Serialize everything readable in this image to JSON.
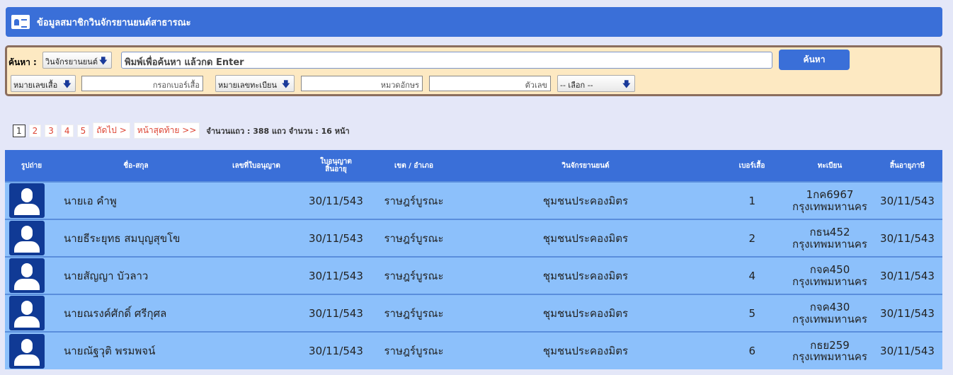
{
  "title": "ข้อมูลสมาชิกวินจักรยานยนต์สาธารณะ",
  "search": {
    "label": "ค้นหา :",
    "type_select": "วินจักรยานยนต์",
    "main_placeholder": "พิมพ์เพื่อค้นหา แล้วกด Enter",
    "button": "ค้นหา",
    "shirt_select": "หมายเลขเสื้อ",
    "shirt_placeholder": "กรอกเบอร์เสื้อ",
    "plate_select": "หมายเลขทะเบียน",
    "category_placeholder": "หมวดอักษร",
    "number_placeholder": "ตัวเลข",
    "province_select": "-- เลือก --"
  },
  "pager": {
    "pages": [
      "1",
      "2",
      "3",
      "4",
      "5"
    ],
    "next": "ถัดไป >",
    "last": "หน้าสุดท้าย >>",
    "info": "จำนวนแถว : 388 แถว  จำนวน : 16 หน้า"
  },
  "columns": [
    "รูปถ่าย",
    "ชื่อ-สกุล",
    "เลขที่ใบอนุญาต",
    "ใบอนุญาต สิ้นอายุ",
    "เขต / อำเภอ",
    "วินจักรยานยนต์",
    "เบอร์เสื้อ",
    "ทะเบียน",
    "สิ้นอายุภาษี"
  ],
  "rows": [
    {
      "name": "นายเอ  คำพู",
      "license_no": "",
      "expire": "30/11/543",
      "district": "ราษฎร์บูรณะ",
      "win": "ชุมชนประคองมิตร",
      "shirt": "1",
      "plate": "1กค6967",
      "province": "กรุงเทพมหานคร",
      "tax": "30/11/543"
    },
    {
      "name": "นายธีระยุทธ  สมบุญสุขโข",
      "license_no": "",
      "expire": "30/11/543",
      "district": "ราษฎร์บูรณะ",
      "win": "ชุมชนประคองมิตร",
      "shirt": "2",
      "plate": "กธน452",
      "province": "กรุงเทพมหานคร",
      "tax": "30/11/543"
    },
    {
      "name": "นายสัญญา  บัวลาว",
      "license_no": "",
      "expire": "30/11/543",
      "district": "ราษฎร์บูรณะ",
      "win": "ชุมชนประคองมิตร",
      "shirt": "4",
      "plate": "กจค450",
      "province": "กรุงเทพมหานคร",
      "tax": "30/11/543"
    },
    {
      "name": "นายณรงค์ศักดิ์  ศรีกุศล",
      "license_no": "",
      "expire": "30/11/543",
      "district": "ราษฎร์บูรณะ",
      "win": "ชุมชนประคองมิตร",
      "shirt": "5",
      "plate": "กจค430",
      "province": "กรุงเทพมหานคร",
      "tax": "30/11/543"
    },
    {
      "name": "นายณัฐวุติ  พรมพจน์",
      "license_no": "",
      "expire": "30/11/543",
      "district": "ราษฎร์บูรณะ",
      "win": "ชุมชนประคองมิตร",
      "shirt": "6",
      "plate": "กธย259",
      "province": "กรุงเทพมหานคร",
      "tax": "30/11/543"
    }
  ]
}
